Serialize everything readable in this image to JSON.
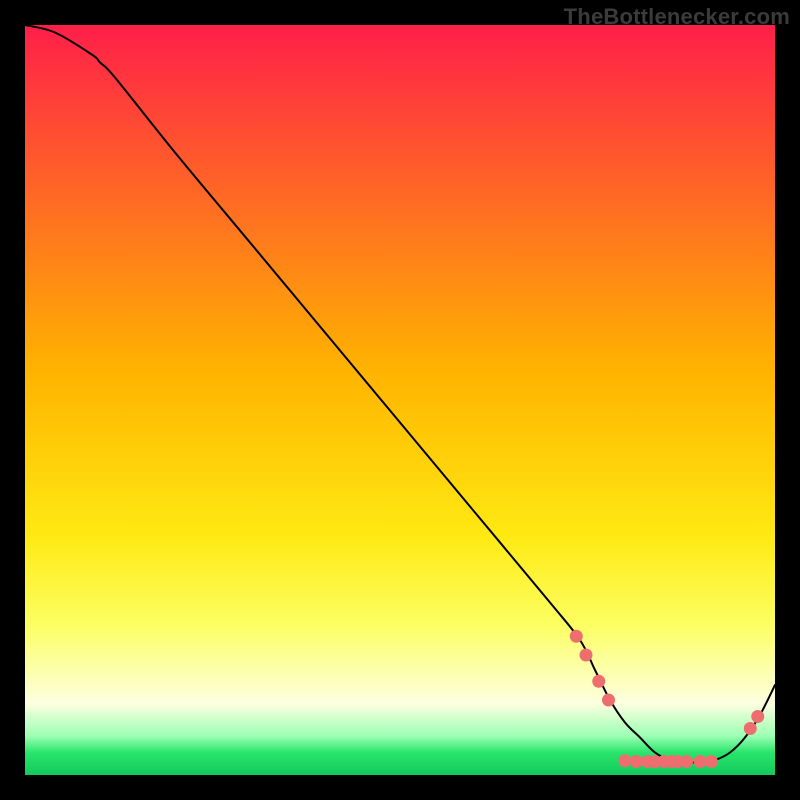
{
  "watermark": "TheBottlenecker.com",
  "chart_data": {
    "type": "line",
    "title": "",
    "xlabel": "",
    "ylabel": "",
    "xlim": [
      0,
      100
    ],
    "ylim": [
      0,
      100
    ],
    "background": {
      "type": "vertical-gradient",
      "stops": [
        {
          "offset": 0.0,
          "color": "#ff1f49"
        },
        {
          "offset": 0.46,
          "color": "#ffb300"
        },
        {
          "offset": 0.68,
          "color": "#ffe912"
        },
        {
          "offset": 0.8,
          "color": "#fcff62"
        },
        {
          "offset": 0.905,
          "color": "#fcffe0"
        },
        {
          "offset": 0.948,
          "color": "#9cffb4"
        },
        {
          "offset": 0.97,
          "color": "#29e56b"
        },
        {
          "offset": 1.0,
          "color": "#13c95c"
        }
      ]
    },
    "series": [
      {
        "name": "curve",
        "color": "#000000",
        "width": 2,
        "x": [
          0,
          4,
          9,
          10,
          12,
          20,
          30,
          40,
          50,
          60,
          70,
          74,
          76,
          78,
          80,
          82,
          84,
          86,
          88,
          90,
          92,
          94,
          96,
          98,
          100
        ],
        "y": [
          100,
          99,
          96,
          95,
          93,
          83,
          71,
          59,
          47,
          35,
          23,
          18,
          14,
          10,
          7,
          5,
          3,
          2,
          1.7,
          1.7,
          2,
          3,
          5,
          8,
          12
        ]
      }
    ],
    "markers": {
      "color": "#ee6d6f",
      "radius": 6.5,
      "points": [
        {
          "x": 73.5,
          "y": 18.5
        },
        {
          "x": 74.8,
          "y": 16.0
        },
        {
          "x": 76.5,
          "y": 12.5
        },
        {
          "x": 77.8,
          "y": 10.0
        },
        {
          "x": 80.0,
          "y": 1.9
        },
        {
          "x": 81.5,
          "y": 1.8
        },
        {
          "x": 83.0,
          "y": 1.8
        },
        {
          "x": 84.0,
          "y": 1.8
        },
        {
          "x": 85.2,
          "y": 1.8
        },
        {
          "x": 86.2,
          "y": 1.8
        },
        {
          "x": 87.0,
          "y": 1.8
        },
        {
          "x": 88.2,
          "y": 1.8
        },
        {
          "x": 90.0,
          "y": 1.8
        },
        {
          "x": 91.5,
          "y": 1.8
        },
        {
          "x": 96.7,
          "y": 6.2
        },
        {
          "x": 97.7,
          "y": 7.8
        }
      ]
    }
  }
}
